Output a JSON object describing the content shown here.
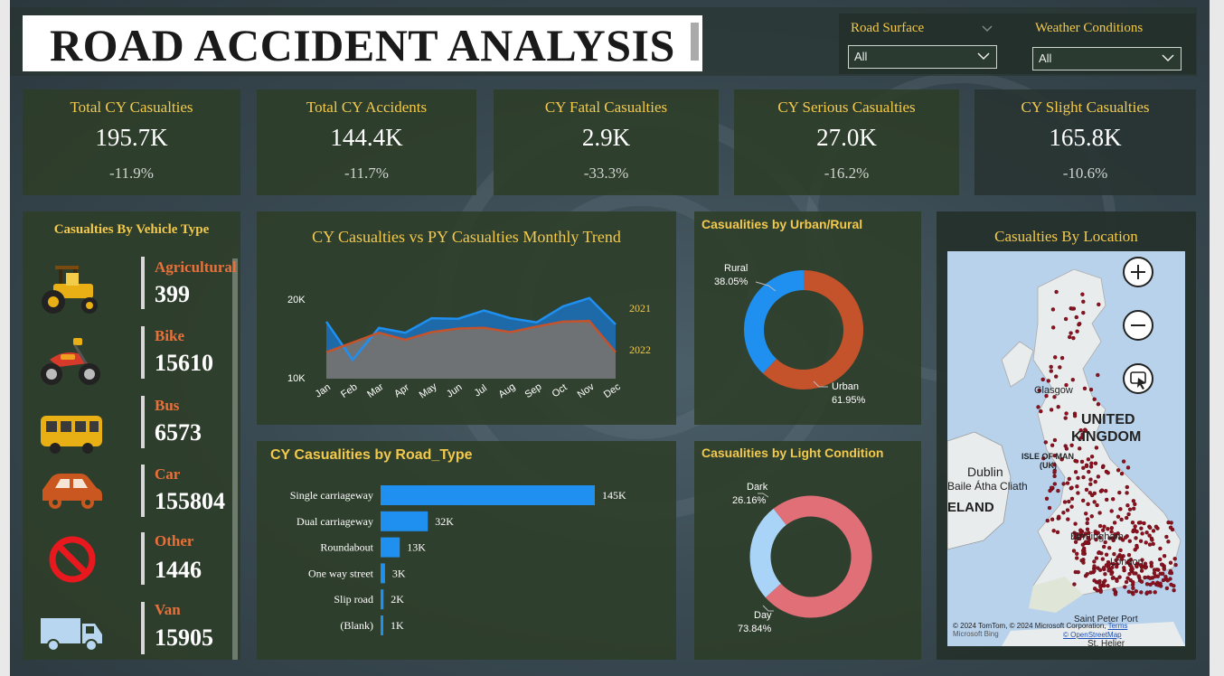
{
  "header": {
    "title": "ROAD ACCIDENT ANALYSIS"
  },
  "filters": [
    {
      "label": "Road Surface",
      "value": "All"
    },
    {
      "label": "Weather Conditions",
      "value": "All"
    }
  ],
  "kpis": [
    {
      "title": "Total CY Casualties",
      "value": "195.7K",
      "change": "-11.9%"
    },
    {
      "title": "Total CY Accidents",
      "value": "144.4K",
      "change": "-11.7%"
    },
    {
      "title": "CY Fatal Casualties",
      "value": "2.9K",
      "change": "-33.3%"
    },
    {
      "title": "CY Serious Casualties",
      "value": "27.0K",
      "change": "-16.2%"
    },
    {
      "title": "CY Slight Casualties",
      "value": "165.8K",
      "change": "-10.6%"
    }
  ],
  "vehicles": {
    "title": "Casualties By Vehicle Type",
    "items": [
      {
        "name": "Agricultural",
        "value": "399",
        "icon": "tractor-icon"
      },
      {
        "name": "Bike",
        "value": "15610",
        "icon": "motorbike-icon"
      },
      {
        "name": "Bus",
        "value": "6573",
        "icon": "bus-icon"
      },
      {
        "name": "Car",
        "value": "155804",
        "icon": "car-icon"
      },
      {
        "name": "Other",
        "value": "1446",
        "icon": "prohibited-icon"
      },
      {
        "name": "Van",
        "value": "15905",
        "icon": "van-icon"
      }
    ]
  },
  "location": {
    "title": "Casualties By Location",
    "labels": {
      "glasgow": "Glasgow",
      "uk": "UNITED",
      "uk2": "KINGDOM",
      "iom": "ISLE OF MAN",
      "iom2": "(UK)",
      "dublin": "Dublin",
      "dublin2": "Baile Átha Cliath",
      "ireland": "ELAND",
      "birmingham": "Birmingham",
      "london": "London",
      "stpeter": "Saint Peter Port",
      "helier": "St. Helier"
    },
    "attribution": "© 2024 TomTom, © 2024 Microsoft Corporation,",
    "terms": "Terms",
    "osm": "© OpenStreetMap",
    "bing": "Microsoft Bing"
  },
  "colors": {
    "cy": "#1f8ff0",
    "py": "#c4522a",
    "day": "#e06f78",
    "dark": "#a9d3f7",
    "accent": "#f2c94c"
  },
  "chart_data": [
    {
      "type": "area",
      "title": "CY Casualties vs PY Casualties Monthly Trend",
      "categories": [
        "Jan",
        "Feb",
        "Mar",
        "Apr",
        "May",
        "Jun",
        "Jul",
        "Aug",
        "Sep",
        "Oct",
        "Nov",
        "Dec"
      ],
      "series": [
        {
          "name": "2021",
          "values": [
            18.2,
            12.7,
            17.3,
            16.6,
            18.7,
            18.6,
            19.8,
            18.7,
            18.1,
            20.4,
            21.6,
            17.8
          ]
        },
        {
          "name": "2022",
          "values": [
            13.8,
            15.2,
            16.6,
            15.6,
            16.7,
            17.2,
            17.3,
            16.7,
            17.5,
            18.2,
            18.3,
            13.8
          ]
        }
      ],
      "yticks": [
        "10K",
        "20K"
      ],
      "ylim": [
        10,
        23
      ]
    },
    {
      "type": "pie",
      "title": "Casualities by Urban/Rural",
      "labels": [
        "Rural",
        "Urban"
      ],
      "values": [
        38.05,
        61.95
      ],
      "value_labels": [
        "38.05%",
        "61.95%"
      ]
    },
    {
      "type": "bar",
      "title": "CY Casualities by Road_Type",
      "categories": [
        "Single carriageway",
        "Dual carriageway",
        "Roundabout",
        "One way street",
        "Slip road",
        "(Blank)"
      ],
      "values": [
        145,
        32,
        13,
        3,
        2,
        1
      ],
      "value_labels": [
        "145K",
        "32K",
        "13K",
        "3K",
        "2K",
        "1K"
      ]
    },
    {
      "type": "pie",
      "title": "Casualities by Light Condition",
      "labels": [
        "Dark",
        "Day"
      ],
      "values": [
        26.16,
        73.84
      ],
      "value_labels": [
        "26.16%",
        "73.84%"
      ]
    }
  ]
}
